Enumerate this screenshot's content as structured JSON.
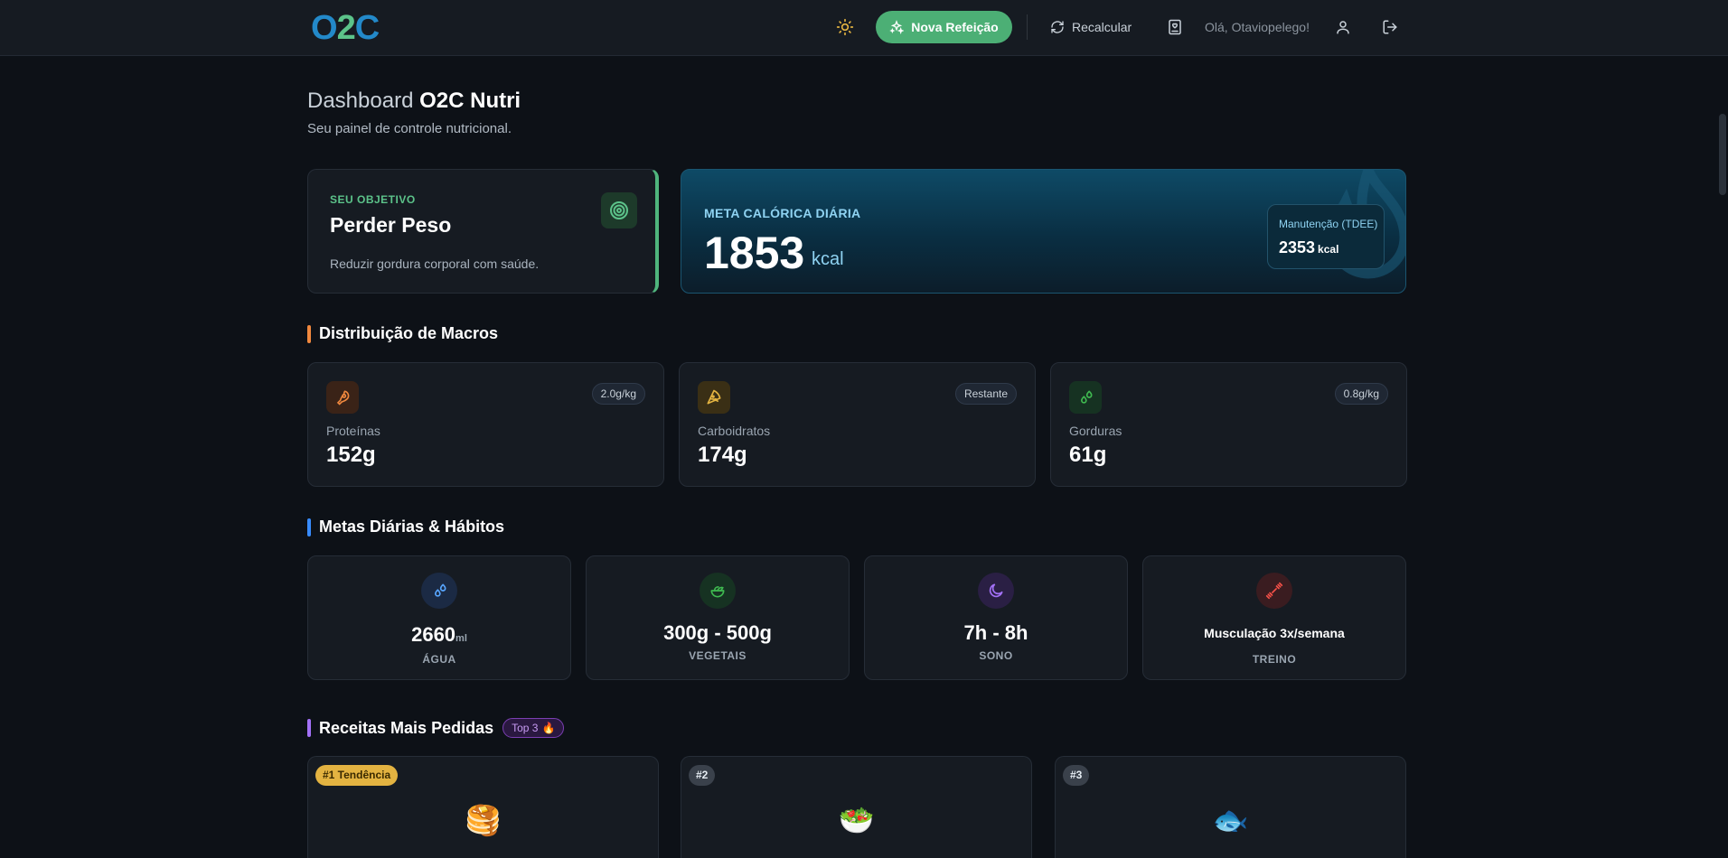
{
  "header": {
    "logo_o": "O",
    "logo_two": "2",
    "logo_c": "C",
    "new_meal_label": "Nova Refeição",
    "recalc_label": "Recalcular",
    "greeting": "Olá, Otaviopelego!"
  },
  "page": {
    "title_prefix": "Dashboard",
    "title_brand": "O2C Nutri",
    "subtitle": "Seu painel de controle nutricional."
  },
  "objective": {
    "kicker": "SEU OBJETIVO",
    "title": "Perder Peso",
    "description": "Reduzir gordura corporal com saúde."
  },
  "calories": {
    "kicker": "META CALÓRICA DIÁRIA",
    "value": "1853",
    "unit": "kcal",
    "tdee_label": "Manutenção (TDEE)",
    "tdee_value": "2353",
    "tdee_unit": "kcal"
  },
  "macros": {
    "section_title": "Distribuição de Macros",
    "items": [
      {
        "label": "Proteínas",
        "value": "152g",
        "badge": "2.0g/kg"
      },
      {
        "label": "Carboidratos",
        "value": "174g",
        "badge": "Restante"
      },
      {
        "label": "Gorduras",
        "value": "61g",
        "badge": "0.8g/kg"
      }
    ]
  },
  "habits": {
    "section_title": "Metas Diárias & Hábitos",
    "items": [
      {
        "value": "2660",
        "unit": "ml",
        "label": "ÁGUA"
      },
      {
        "value": "300g - 500g",
        "label": "VEGETAIS"
      },
      {
        "value": "7h - 8h",
        "label": "SONO"
      },
      {
        "value": "Musculação 3x/semana",
        "label": "TREINO"
      }
    ]
  },
  "recipes": {
    "section_title": "Receitas Mais Pedidas",
    "top_badge": "Top 3",
    "items": [
      {
        "rank": "#1 Tendência",
        "emoji": "🥞"
      },
      {
        "rank": "#2",
        "emoji": "🥗"
      },
      {
        "rank": "#3",
        "emoji": "🐟"
      }
    ]
  },
  "colors": {
    "accent_green": "#4caf75",
    "protein": "#f0883e",
    "carbs": "#e3b341",
    "fat": "#3fb950",
    "water": "#58a6ff",
    "sleep": "#a371f7",
    "workout": "#f85149"
  }
}
